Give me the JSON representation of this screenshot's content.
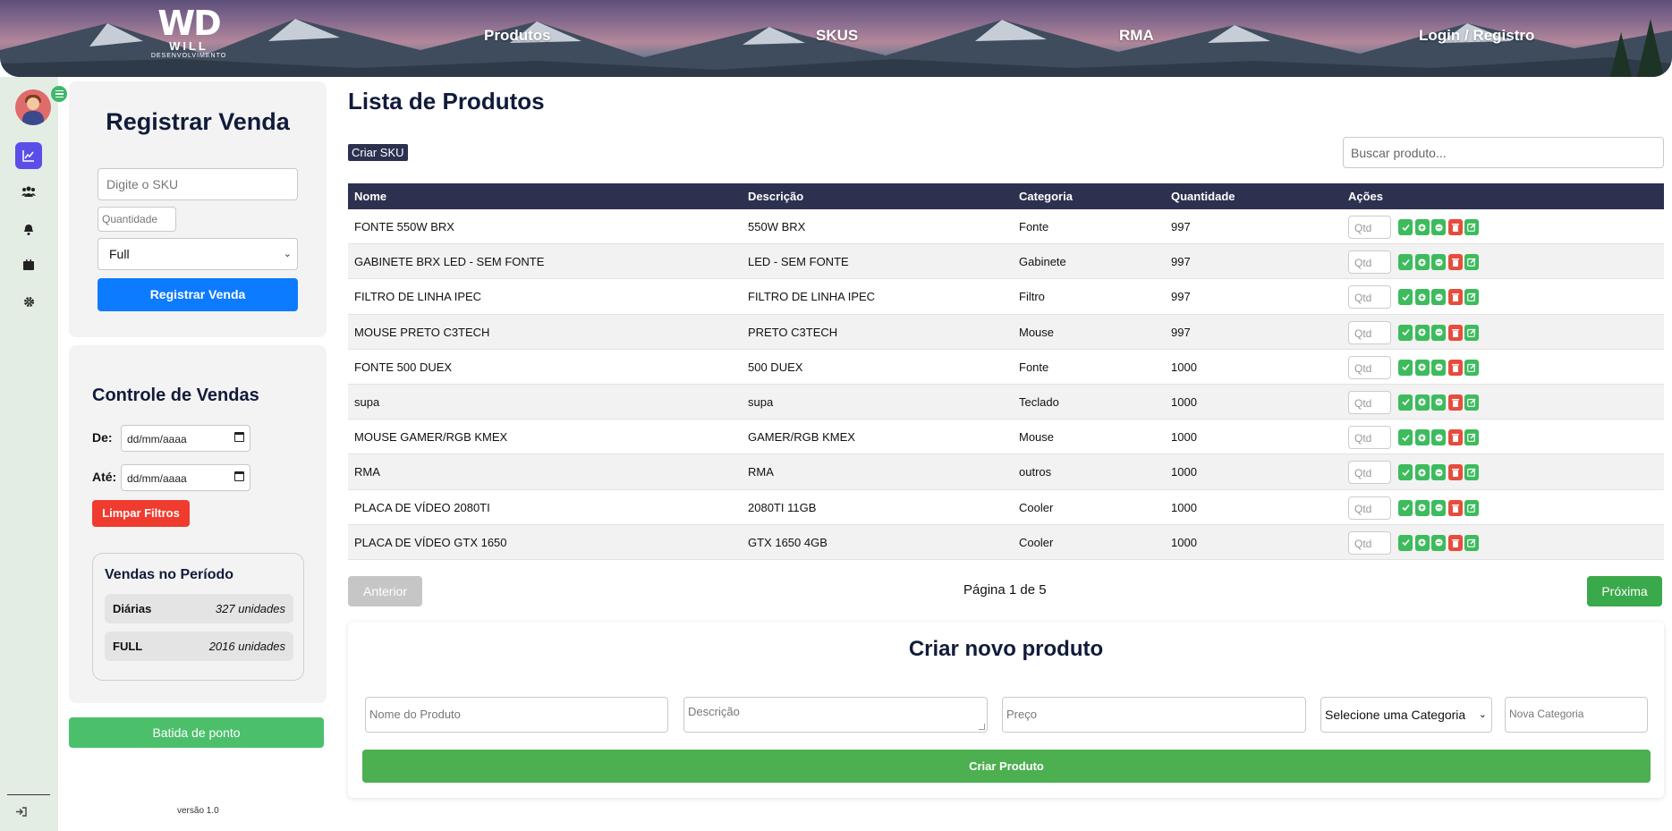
{
  "header": {
    "logo": {
      "main": "WD",
      "line1": "WILL",
      "line2": "DESENVOLVIMENTO"
    },
    "nav": [
      "Produtos",
      "SKUS",
      "RMA",
      "Login / Registro"
    ]
  },
  "rail": {
    "icons": [
      "chart-icon",
      "users-icon",
      "bell-icon",
      "calendar-icon",
      "gear-icon"
    ],
    "exit_icon": "sign-out-icon"
  },
  "registrar": {
    "title": "Registrar Venda",
    "sku_placeholder": "Digite o SKU",
    "qty_placeholder": "Quantidade",
    "type_selected": "Full",
    "submit_label": "Registrar Venda"
  },
  "controle": {
    "title": "Controle de Vendas",
    "from_label": "De:",
    "to_label": "Até:",
    "date_placeholder": "dd/mm/aaaa",
    "clear_label": "Limpar Filtros",
    "period_title": "Vendas no Período",
    "rows": [
      {
        "key": "Diárias",
        "value": "327 unidades"
      },
      {
        "key": "FULL",
        "value": "2016 unidades"
      }
    ]
  },
  "ponto_label": "Batida de ponto",
  "version": "versão 1.0",
  "main": {
    "title": "Lista de Produtos",
    "create_sku_label": "Criar SKU",
    "search_placeholder": "Buscar produto...",
    "columns": [
      "Nome",
      "Descrição",
      "Categoria",
      "Quantidade",
      "Ações"
    ],
    "qtd_placeholder": "Qtd",
    "rows": [
      {
        "nome": "FONTE 550W BRX",
        "descricao": "550W BRX",
        "categoria": "Fonte",
        "quantidade": "997"
      },
      {
        "nome": "GABINETE BRX LED - SEM FONTE",
        "descricao": "LED - SEM FONTE",
        "categoria": "Gabinete",
        "quantidade": "997"
      },
      {
        "nome": "FILTRO DE LINHA IPEC",
        "descricao": "FILTRO DE LINHA IPEC",
        "categoria": "Filtro",
        "quantidade": "997"
      },
      {
        "nome": "MOUSE PRETO C3TECH",
        "descricao": "PRETO C3TECH",
        "categoria": "Mouse",
        "quantidade": "997"
      },
      {
        "nome": "FONTE 500 DUEX",
        "descricao": "500 DUEX",
        "categoria": "Fonte",
        "quantidade": "1000"
      },
      {
        "nome": "supa",
        "descricao": "supa",
        "categoria": "Teclado",
        "quantidade": "1000"
      },
      {
        "nome": "MOUSE GAMER/RGB KMEX",
        "descricao": "GAMER/RGB KMEX",
        "categoria": "Mouse",
        "quantidade": "1000"
      },
      {
        "nome": "RMA",
        "descricao": "RMA",
        "categoria": "outros",
        "quantidade": "1000"
      },
      {
        "nome": "PLACA DE VÍDEO 2080TI",
        "descricao": "2080TI 11GB",
        "categoria": "Cooler",
        "quantidade": "1000"
      },
      {
        "nome": "PLACA DE VÍDEO GTX 1650",
        "descricao": "GTX 1650 4GB",
        "categoria": "Cooler",
        "quantidade": "1000"
      }
    ],
    "prev_label": "Anterior",
    "page_info": "Página 1 de 5",
    "next_label": "Próxima"
  },
  "create": {
    "title": "Criar novo produto",
    "name_placeholder": "Nome do Produto",
    "desc_placeholder": "Descrição",
    "price_placeholder": "Preço",
    "category_selected": "Selecione uma Categoria",
    "new_category_placeholder": "Nova Categoria",
    "submit_label": "Criar Produto"
  },
  "colors": {
    "navy": "#2d3150",
    "blue": "#0d7bff",
    "green": "#4caf50",
    "red": "#f03b2f",
    "rail_active": "#5b4ee8"
  }
}
